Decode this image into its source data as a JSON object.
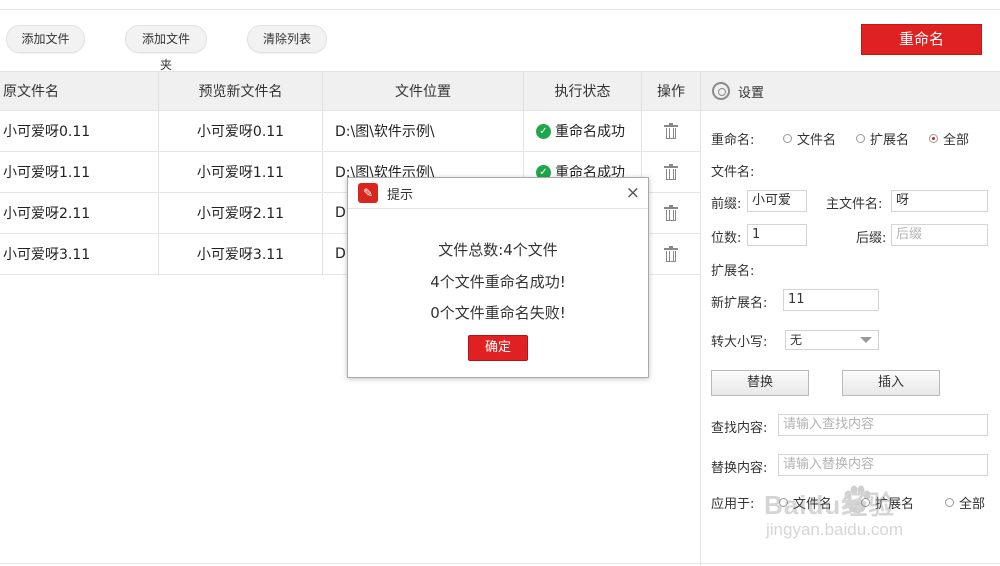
{
  "toolbar": {
    "add_file": "添加文件",
    "add_folder": "添加文件夹",
    "clear_list": "清除列表",
    "rename": "重命名"
  },
  "table": {
    "headers": [
      "原文件名",
      "预览新文件名",
      "文件位置",
      "执行状态",
      "操作"
    ],
    "rows": [
      {
        "original": "小可爱呀0.11",
        "preview": "小可爱呀0.11",
        "location": "D:\\图\\软件示例\\",
        "status": "重命名成功"
      },
      {
        "original": "小可爱呀1.11",
        "preview": "小可爱呀1.11",
        "location": "D:\\图\\软件示例\\",
        "status": "重命名成功"
      },
      {
        "original": "小可爱呀2.11",
        "preview": "小可爱呀2.11",
        "location": "D:",
        "status": ""
      },
      {
        "original": "小可爱呀3.11",
        "preview": "小可爱呀3.11",
        "location": "D:",
        "status": ""
      }
    ]
  },
  "settings": {
    "title": "设置",
    "rename_label": "重命名:",
    "rename_options": [
      "文件名",
      "扩展名",
      "全部"
    ],
    "rename_selected": "全部",
    "filename_label": "文件名:",
    "prefix_label": "前缀:",
    "prefix_value": "小可爱",
    "main_name_label": "主文件名:",
    "main_name_value": "呀",
    "digits_label": "位数:",
    "digits_value": "1",
    "suffix_label": "后缀:",
    "suffix_placeholder": "后缀",
    "ext_label": "扩展名:",
    "new_ext_label": "新扩展名:",
    "new_ext_value": "11",
    "case_label": "转大小写:",
    "case_value": "无",
    "replace_btn": "替换",
    "insert_btn": "插入",
    "find_label": "查找内容:",
    "find_placeholder": "请输入查找内容",
    "replace_label": "替换内容:",
    "replace_placeholder": "请输入替换内容",
    "apply_label": "应用于:",
    "apply_options": [
      "文件名",
      "扩展名",
      "全部"
    ]
  },
  "dialog": {
    "title": "提示",
    "close": "×",
    "line1": "文件总数:4个文件",
    "line2": "4个文件重命名成功!",
    "line3": "0个文件重命名失败!",
    "ok": "确定"
  },
  "watermark": {
    "brand": "Baidu经验",
    "url": "jingyan.baidu.com"
  }
}
